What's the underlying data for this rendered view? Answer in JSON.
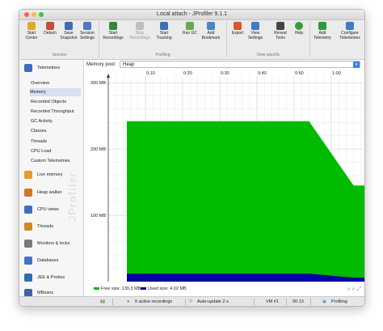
{
  "window": {
    "title": "Local attach - JProfiler 9.1.1"
  },
  "toolbar": {
    "buttons": [
      {
        "label": "Start Center",
        "icon": "start-center-icon",
        "color": "#e0a92a"
      },
      {
        "label": "Detach",
        "icon": "detach-icon",
        "color": "#c44d3a"
      },
      {
        "label": "Save Snapshot",
        "icon": "save-snapshot-icon",
        "color": "#3f6cae"
      },
      {
        "label": "Session Settings",
        "icon": "session-settings-icon",
        "color": "#4b79c4"
      },
      {
        "label": "Start Recordings",
        "icon": "start-recordings-icon",
        "color": "#2e8b3a"
      },
      {
        "label": "Stop Recordings",
        "icon": "stop-recordings-icon",
        "color": "#8a8a8a"
      },
      {
        "label": "Start Tracking",
        "icon": "start-tracking-icon",
        "color": "#3d6fb5"
      },
      {
        "label": "Run GC",
        "icon": "run-gc-icon",
        "color": "#6aa84f"
      },
      {
        "label": "Add Bookmark",
        "icon": "add-bookmark-icon",
        "color": "#4a86c5"
      },
      {
        "label": "Export",
        "icon": "export-icon",
        "color": "#d05a2a"
      },
      {
        "label": "View Settings",
        "icon": "view-settings-icon",
        "color": "#3b7dc9"
      },
      {
        "label": "Reveal Tools",
        "icon": "reveal-tools-icon",
        "color": "#444444"
      },
      {
        "label": "Help",
        "icon": "help-icon",
        "color": "#3a9a3a"
      },
      {
        "label": "Add Telemetry",
        "icon": "add-telemetry-icon",
        "color": "#2e9a3a"
      },
      {
        "label": "Configure Telemetries",
        "icon": "configure-telemetries-icon",
        "color": "#3b7dc9"
      }
    ],
    "groups": {
      "session": "Session",
      "profiling": "Profiling",
      "view_specific": "View specific"
    }
  },
  "sidebar": {
    "header": "Telemetries",
    "items": [
      "Overview",
      "Memory",
      "Recorded Objects",
      "Recorded Throughput",
      "GC Activity",
      "Classes",
      "Threads",
      "CPU Load",
      "Custom Telemetries"
    ],
    "selected": "Memory",
    "sections": [
      {
        "label": "Live memory",
        "icon": "live-memory-icon",
        "color": "#e79b2b"
      },
      {
        "label": "Heap walker",
        "icon": "heap-walker-icon",
        "color": "#d0762f"
      },
      {
        "label": "CPU views",
        "icon": "cpu-views-icon",
        "color": "#3c6ec2"
      },
      {
        "label": "Threads",
        "icon": "threads-icon",
        "color": "#d18a26"
      },
      {
        "label": "Monitors & locks",
        "icon": "monitors-locks-icon",
        "color": "#7a7a7a"
      },
      {
        "label": "Databases",
        "icon": "databases-icon",
        "color": "#3f74c5"
      },
      {
        "label": "JEE & Probes",
        "icon": "jee-probes-icon",
        "color": "#2f6db0"
      },
      {
        "label": "MBeans",
        "icon": "mbeans-icon",
        "color": "#3d64a8"
      }
    ],
    "watermark": "JProfiler"
  },
  "main": {
    "pool_label": "Memory pool:",
    "pool_value": "Heap"
  },
  "chart_data": {
    "type": "area",
    "x_unit": "min:sec",
    "x_ticks": [
      "0:10",
      "0:20",
      "0:30",
      "0:40",
      "0:50",
      "1:00",
      "1:10",
      "1:20",
      "1:30",
      "1:40"
    ],
    "y_ticks": [
      "300 MB",
      "200 MB",
      "100 MB"
    ],
    "ylim": [
      0,
      310
    ],
    "series": [
      {
        "name": "Free size: 139.3 MB",
        "color": "#00bb00",
        "points": [
          [
            0.5,
            242
          ],
          [
            5.4,
            242
          ],
          [
            6.6,
            145
          ],
          [
            7.4,
            145
          ]
        ]
      },
      {
        "name": "Used size: 4.02 MB",
        "color": "#0000a0",
        "points": [
          [
            0.5,
            12
          ],
          [
            5.4,
            12
          ],
          [
            6.6,
            6
          ],
          [
            7.4,
            6
          ]
        ]
      }
    ]
  },
  "status": {
    "recordings": "0 active recordings",
    "autoupdate": "Auto-update 2 s",
    "vm": "VM #1",
    "time": "00:13",
    "profiling": "Profiling"
  }
}
